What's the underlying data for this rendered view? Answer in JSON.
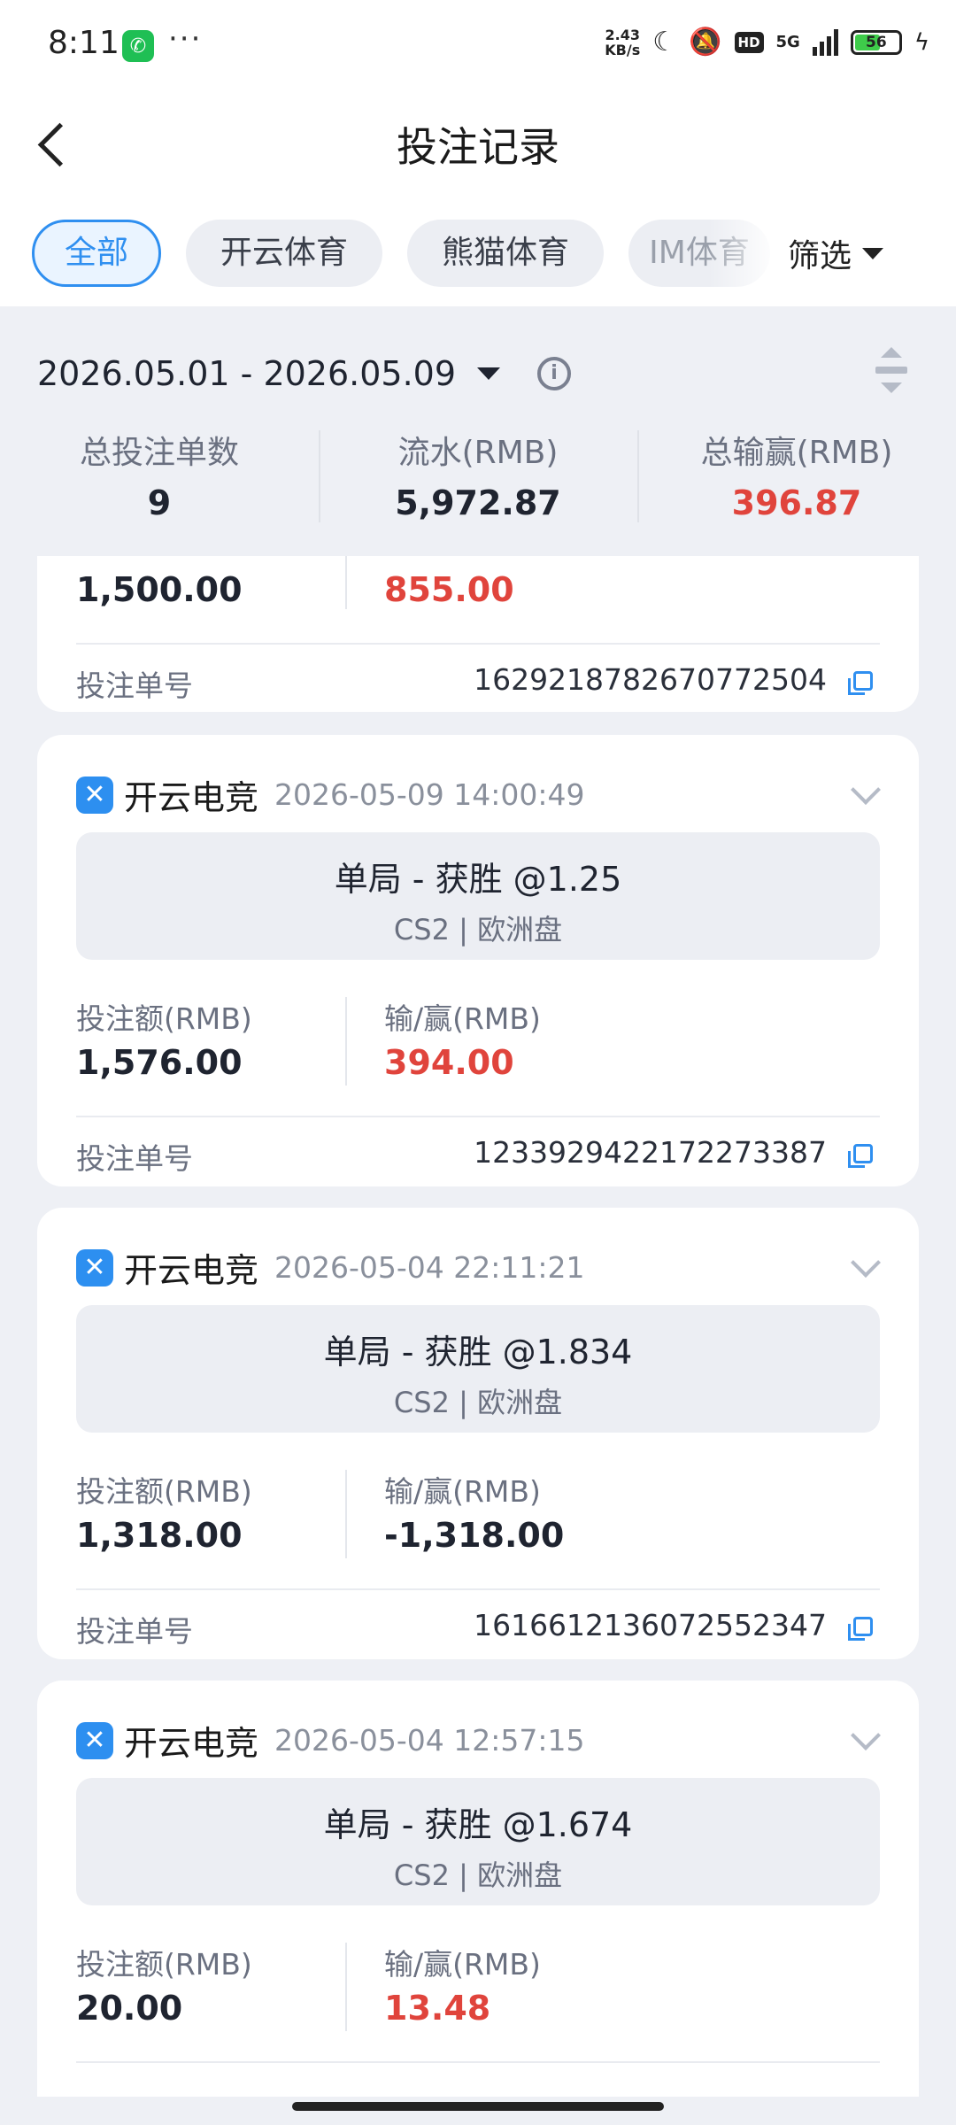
{
  "status": {
    "time": "8:11",
    "dots": "···",
    "speed_top": "2.43",
    "speed_bottom": "KB/s",
    "hd": "HD",
    "network": "5G",
    "battery": "56"
  },
  "header": {
    "title": "投注记录"
  },
  "tabs": [
    {
      "label": "全部",
      "active": true
    },
    {
      "label": "开云体育",
      "active": false
    },
    {
      "label": "熊猫体育",
      "active": false
    },
    {
      "label": "IM体育",
      "active": false
    }
  ],
  "filter_label": "筛选",
  "date_range": "2026.05.01 - 2026.05.09",
  "summary": [
    {
      "label": "总投注单数",
      "value": "9"
    },
    {
      "label": "流水(RMB)",
      "value": "5,972.87"
    },
    {
      "label": "总输赢(RMB)",
      "value": "396.87"
    }
  ],
  "partial_card": {
    "stake": "1,500.00",
    "win": "855.00",
    "order_label": "投注单号",
    "order_no": "1629218782670772504"
  },
  "cards": [
    {
      "brand": "开云电竞",
      "time": "2026-05-09 14:00:49",
      "market": "单局 - 获胜 @1.25",
      "sub": "CS2 | 欧洲盘",
      "stake_label": "投注额(RMB)",
      "stake": "1,576.00",
      "win_label": "输/赢(RMB)",
      "win": "394.00",
      "order_label": "投注单号",
      "order_no": "1233929422172273387"
    },
    {
      "brand": "开云电竞",
      "time": "2026-05-04 22:11:21",
      "market": "单局 - 获胜 @1.834",
      "sub": "CS2 | 欧洲盘",
      "stake_label": "投注额(RMB)",
      "stake": "1,318.00",
      "win_label": "输/赢(RMB)",
      "win": "-1,318.00",
      "order_label": "投注单号",
      "order_no": "1616612136072552347"
    },
    {
      "brand": "开云电竞",
      "time": "2026-05-04 12:57:15",
      "market": "单局 - 获胜 @1.674",
      "sub": "CS2 | 欧洲盘",
      "stake_label": "投注额(RMB)",
      "stake": "20.00",
      "win_label": "输/赢(RMB)",
      "win": "13.48"
    }
  ],
  "colors": {
    "accent": "#2f8ff0",
    "win_red": "#e0443c",
    "bg": "#eef0f5"
  }
}
